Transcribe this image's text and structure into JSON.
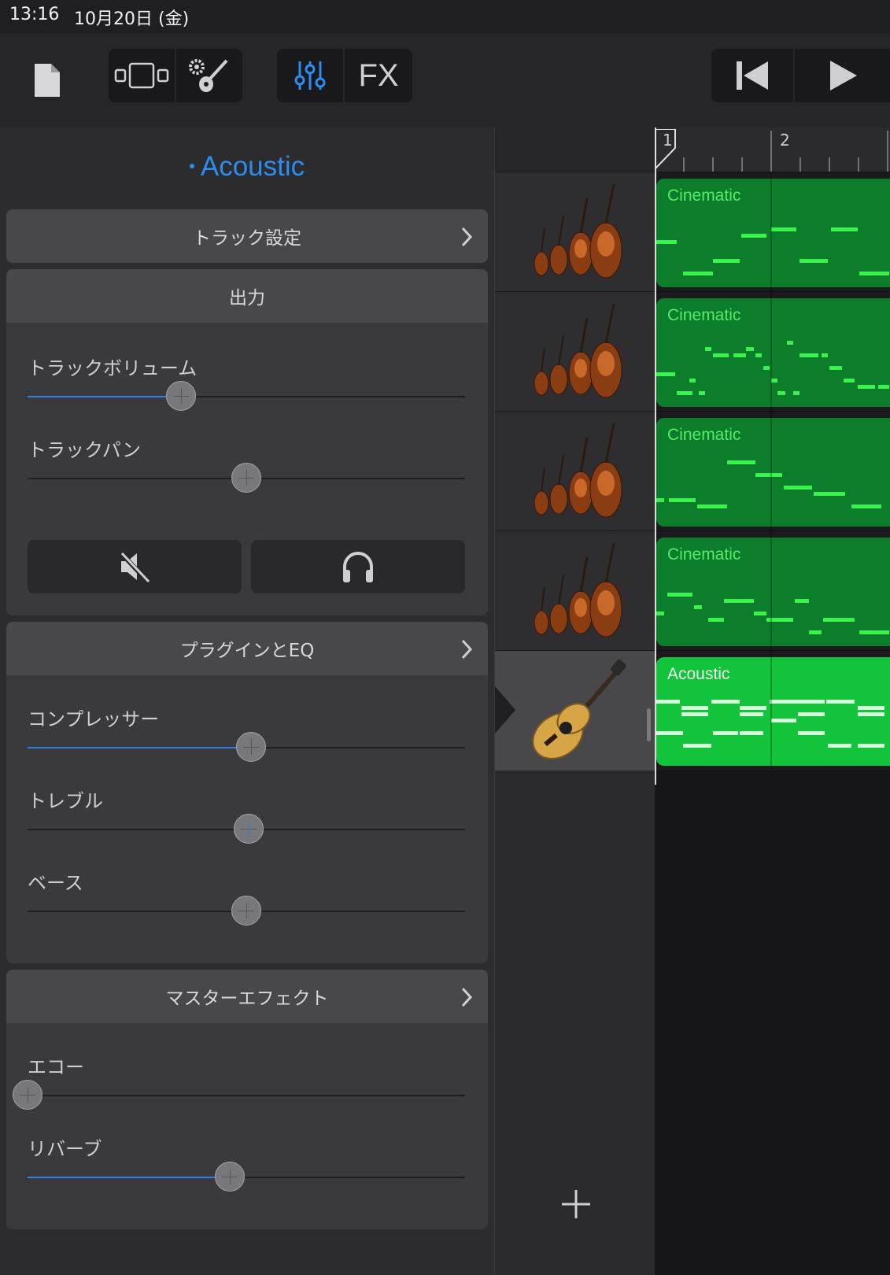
{
  "status_bar": {
    "time": "13:16",
    "date": "10月20日 (金)"
  },
  "toolbar": {
    "fx_label": "FX"
  },
  "panel": {
    "title": "Acoustic",
    "track_settings": {
      "label": "トラック設定"
    },
    "output": {
      "header": "出力",
      "volume_label": "トラックボリューム",
      "volume_value": 0.35,
      "pan_label": "トラックパン",
      "pan_value": 0.5
    },
    "plugins": {
      "header": "プラグインとEQ",
      "compressor_label": "コンプレッサー",
      "compressor_value": 0.51,
      "treble_label": "トレブル",
      "treble_value": 0.505,
      "bass_label": "ベース",
      "bass_value": 0.5
    },
    "master": {
      "header": "マスターエフェクト",
      "echo_label": "エコー",
      "echo_value": 0.0,
      "reverb_label": "リバーブ",
      "reverb_value": 0.463
    }
  },
  "ruler": {
    "bar1": "1",
    "bar2": "2"
  },
  "tracks": [
    {
      "region": "Cinematic",
      "icon": "strings-ensemble-icon"
    },
    {
      "region": "Cinematic",
      "icon": "strings-ensemble-icon"
    },
    {
      "region": "Cinematic",
      "icon": "strings-ensemble-icon"
    },
    {
      "region": "Cinematic",
      "icon": "strings-ensemble-icon"
    },
    {
      "region": "Acoustic",
      "icon": "acoustic-guitar-icon"
    }
  ],
  "colors": {
    "accent": "#2d8cf0",
    "region_dark": "#0c7d2a",
    "region_bright": "#13c33b"
  }
}
